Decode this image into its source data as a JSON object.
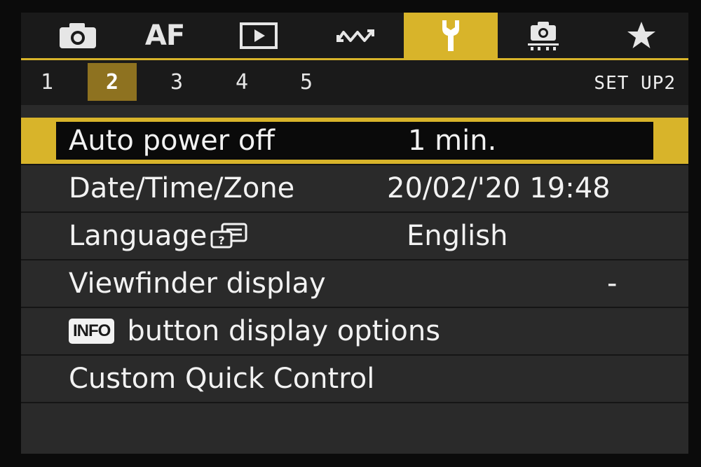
{
  "tabs": [
    {
      "name": "shooting",
      "icon": "camera-icon",
      "active": false
    },
    {
      "name": "af",
      "label": "AF",
      "active": false
    },
    {
      "name": "playback",
      "icon": "play-icon",
      "active": false
    },
    {
      "name": "wireless",
      "icon": "wireless-wave-icon",
      "active": false
    },
    {
      "name": "setup",
      "icon": "wrench-icon",
      "active": true
    },
    {
      "name": "custom-functions",
      "icon": "custom-camera-icon",
      "active": false
    },
    {
      "name": "my-menu",
      "icon": "star-icon",
      "active": false
    }
  ],
  "subtabs": [
    "1",
    "2",
    "3",
    "4",
    "5"
  ],
  "active_subtab": "2",
  "menu_code": "SET UP2",
  "menu_items": [
    {
      "label": "Auto power off",
      "value": "1 min.",
      "selected": true
    },
    {
      "label": "Date/Time/Zone",
      "value": "20/02/'20 19:48",
      "selected": false
    },
    {
      "label": "Language",
      "value": "English",
      "icon": "language-icon",
      "selected": false
    },
    {
      "label": "Viewfinder display",
      "value": "-",
      "selected": false
    },
    {
      "label": "button display options",
      "badge": "INFO",
      "selected": false
    },
    {
      "label": "Custom Quick Control",
      "value": "",
      "selected": false
    }
  ],
  "colors": {
    "accent": "#d8b42a",
    "subtab_active": "#8e7220",
    "background": "#2a2a2a"
  }
}
